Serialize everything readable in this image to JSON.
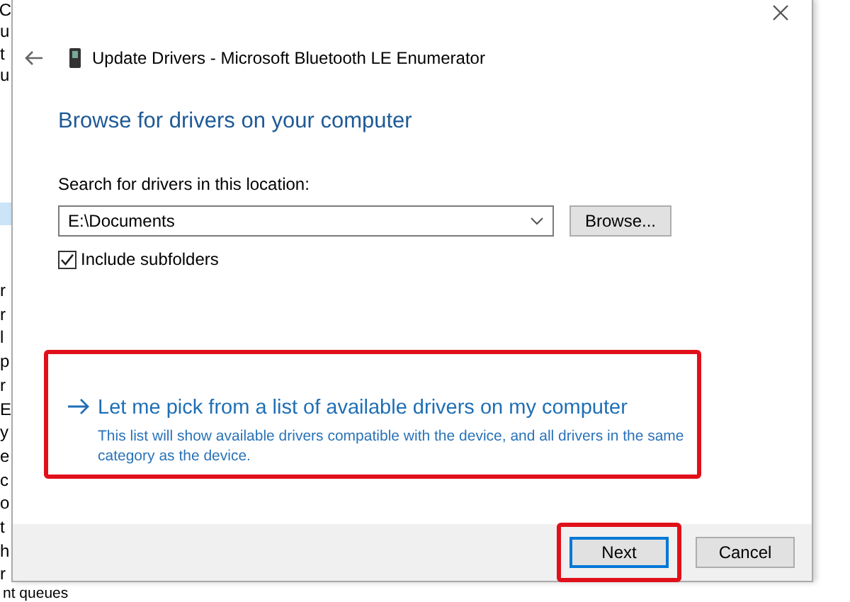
{
  "background_window": {
    "top_fragments": [
      "C",
      "u",
      "t",
      "u"
    ],
    "lower_fragments": [
      "r",
      "r",
      "l",
      "p",
      "r",
      "E",
      "y",
      "e",
      "c",
      "o",
      "t",
      "h",
      "r"
    ],
    "bottom_text": "nt queues"
  },
  "dialog": {
    "title": "Update Drivers - Microsoft Bluetooth LE Enumerator",
    "heading": "Browse for drivers on your computer",
    "search_label": "Search for drivers in this location:",
    "location": {
      "value": "E:\\Documents"
    },
    "browse_button": "Browse...",
    "include_subfolders": {
      "label": "Include subfolders",
      "checked": true
    },
    "pick_option": {
      "title": "Let me pick from a list of available drivers on my computer",
      "description": "This list will show available drivers compatible with the device, and all drivers in the same category as the device."
    },
    "buttons": [
      {
        "label": "Next",
        "default": true
      },
      {
        "label": "Cancel",
        "default": false
      }
    ]
  }
}
